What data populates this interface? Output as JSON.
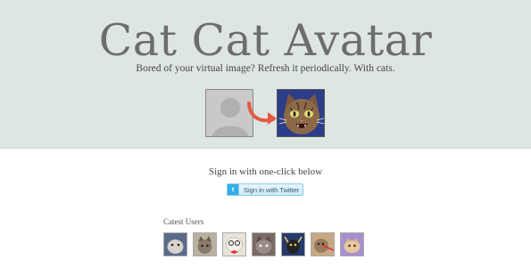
{
  "hero": {
    "title": "Cat Cat Avatar",
    "subtitle": "Bored of your virtual image? Refresh it periodically. With cats.",
    "default_avatar_icon": "default-user-icon",
    "arrow_icon": "curved-arrow-icon",
    "cat_avatar_icon": "cat-face-icon",
    "arrow_color": "#e55a44",
    "background_color": "#dde6e3"
  },
  "signin": {
    "prompt": "Sign in with one-click below",
    "button_label": "Sign in with Twitter",
    "button_icon": "twitter-icon",
    "button_icon_glyph": "t"
  },
  "latest": {
    "label": "Catest Users",
    "users": [
      {
        "icon": "cat-avatar-icon",
        "bg": "#5a6a8a"
      },
      {
        "icon": "cat-avatar-icon",
        "bg": "#b9b0a0"
      },
      {
        "icon": "cat-avatar-icon",
        "bg": "#e8e2d8"
      },
      {
        "icon": "cat-avatar-icon",
        "bg": "#7a6a66"
      },
      {
        "icon": "cat-avatar-icon",
        "bg": "#283a6a"
      },
      {
        "icon": "cat-avatar-icon",
        "bg": "#c8a884"
      },
      {
        "icon": "cat-avatar-icon",
        "bg": "#a890d0"
      }
    ]
  }
}
